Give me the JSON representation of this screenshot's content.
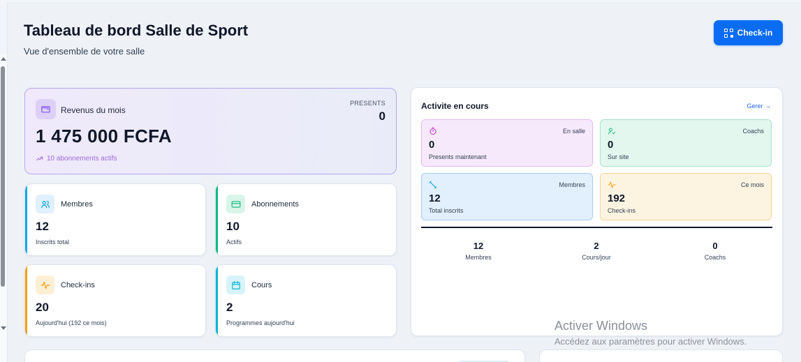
{
  "header": {
    "title": "Tableau de bord Salle de Sport",
    "subtitle": "Vue d'ensemble de votre salle",
    "checkin_label": "Check-in"
  },
  "revenue": {
    "label": "Revenus du mois",
    "amount": "1 475 000 FCFA",
    "sub": "10 abonnements actifs",
    "present_label": "PRESENTS",
    "present_value": "0"
  },
  "stats": [
    {
      "label": "Membres",
      "value": "12",
      "sub": "Inscrits total",
      "icon": "users-icon",
      "color": "#0ea5e9"
    },
    {
      "label": "Abonnements",
      "value": "10",
      "sub": "Actifs",
      "icon": "credit-card-icon",
      "color": "#10b981"
    },
    {
      "label": "Check-ins",
      "value": "20",
      "sub": "Aujourd'hui (192 ce mois)",
      "icon": "activity-icon",
      "color": "#f59e0b"
    },
    {
      "label": "Cours",
      "value": "2",
      "sub": "Programmes aujourd'hui",
      "icon": "calendar-icon",
      "color": "#06b6d4"
    }
  ],
  "activity": {
    "title": "Activite en cours",
    "manage_label": "Gerer →",
    "tiles": [
      {
        "label": "En salle",
        "value": "0",
        "sub": "Presents maintenant",
        "icon": "timer-icon"
      },
      {
        "label": "Coachs",
        "value": "0",
        "sub": "Sur site",
        "icon": "user-check-icon"
      },
      {
        "label": "Membres",
        "value": "12",
        "sub": "Total inscrits",
        "icon": "dumbbell-icon"
      },
      {
        "label": "Ce mois",
        "value": "192",
        "sub": "Check-ins",
        "icon": "pulse-icon"
      }
    ],
    "summary": [
      {
        "value": "12",
        "label": "Membres"
      },
      {
        "value": "2",
        "label": "Cours/jour"
      },
      {
        "value": "0",
        "label": "Coachs"
      }
    ]
  },
  "watermark": {
    "title": "Activer Windows",
    "sub": "Accédez aux paramètres pour activer Windows."
  }
}
